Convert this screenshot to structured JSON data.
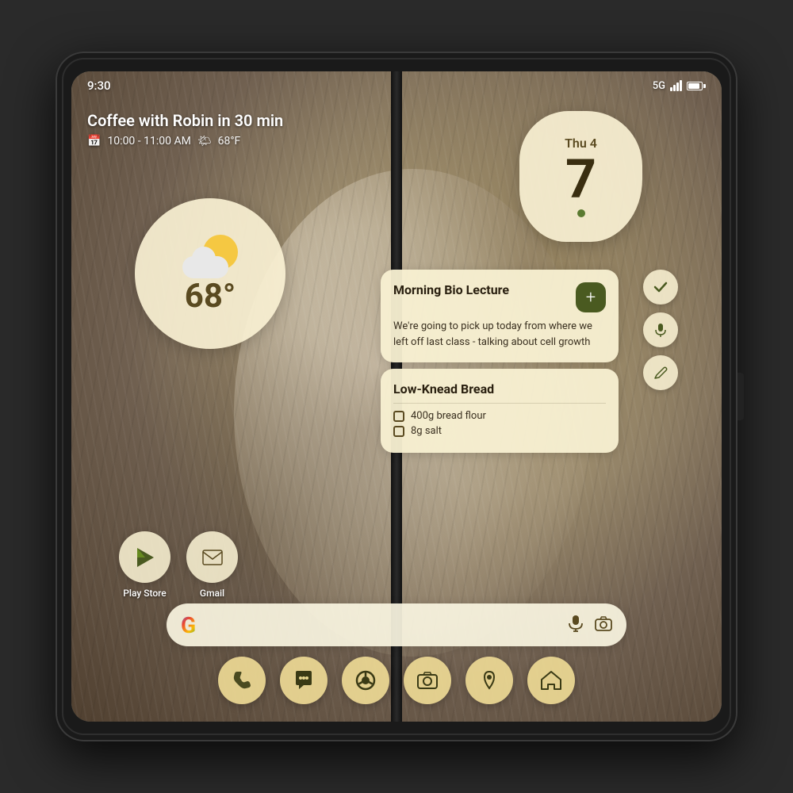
{
  "status": {
    "time": "9:30",
    "network": "5G",
    "signal_label": "signal-icon",
    "battery_label": "battery-icon"
  },
  "calendar_notification": {
    "title": "Coffee with Robin in 30 min",
    "time": "10:00 - 11:00 AM",
    "weather_inline": "☁",
    "temp_inline": "68°F"
  },
  "weather_widget": {
    "temperature": "68°"
  },
  "date_widget": {
    "day": "Thu 4",
    "number": "7"
  },
  "notes_widget": {
    "note1": {
      "title": "Morning Bio Lecture",
      "body": "We're going to pick up today from where we left off last class - talking about cell growth",
      "add_btn_label": "+"
    },
    "note2": {
      "title": "Low-Knead Bread",
      "items": [
        "400g bread flour",
        "8g salt"
      ]
    }
  },
  "side_actions": [
    {
      "icon": "✓",
      "name": "check-action"
    },
    {
      "icon": "🎤",
      "name": "mic-action"
    },
    {
      "icon": "✏️",
      "name": "edit-action"
    }
  ],
  "app_icons": [
    {
      "label": "Play Store",
      "icon": "▶",
      "name": "play-store"
    },
    {
      "label": "Gmail",
      "icon": "M",
      "name": "gmail"
    }
  ],
  "search_bar": {
    "google_letter": "G",
    "mic_icon": "mic-icon",
    "camera_icon": "camera-icon"
  },
  "dock": [
    {
      "icon": "📞",
      "name": "phone-dock"
    },
    {
      "icon": "💬",
      "name": "messages-dock"
    },
    {
      "icon": "🌐",
      "name": "chrome-dock"
    },
    {
      "icon": "📷",
      "name": "camera-dock"
    },
    {
      "icon": "📍",
      "name": "maps-dock"
    },
    {
      "icon": "🏠",
      "name": "home-dock"
    }
  ]
}
